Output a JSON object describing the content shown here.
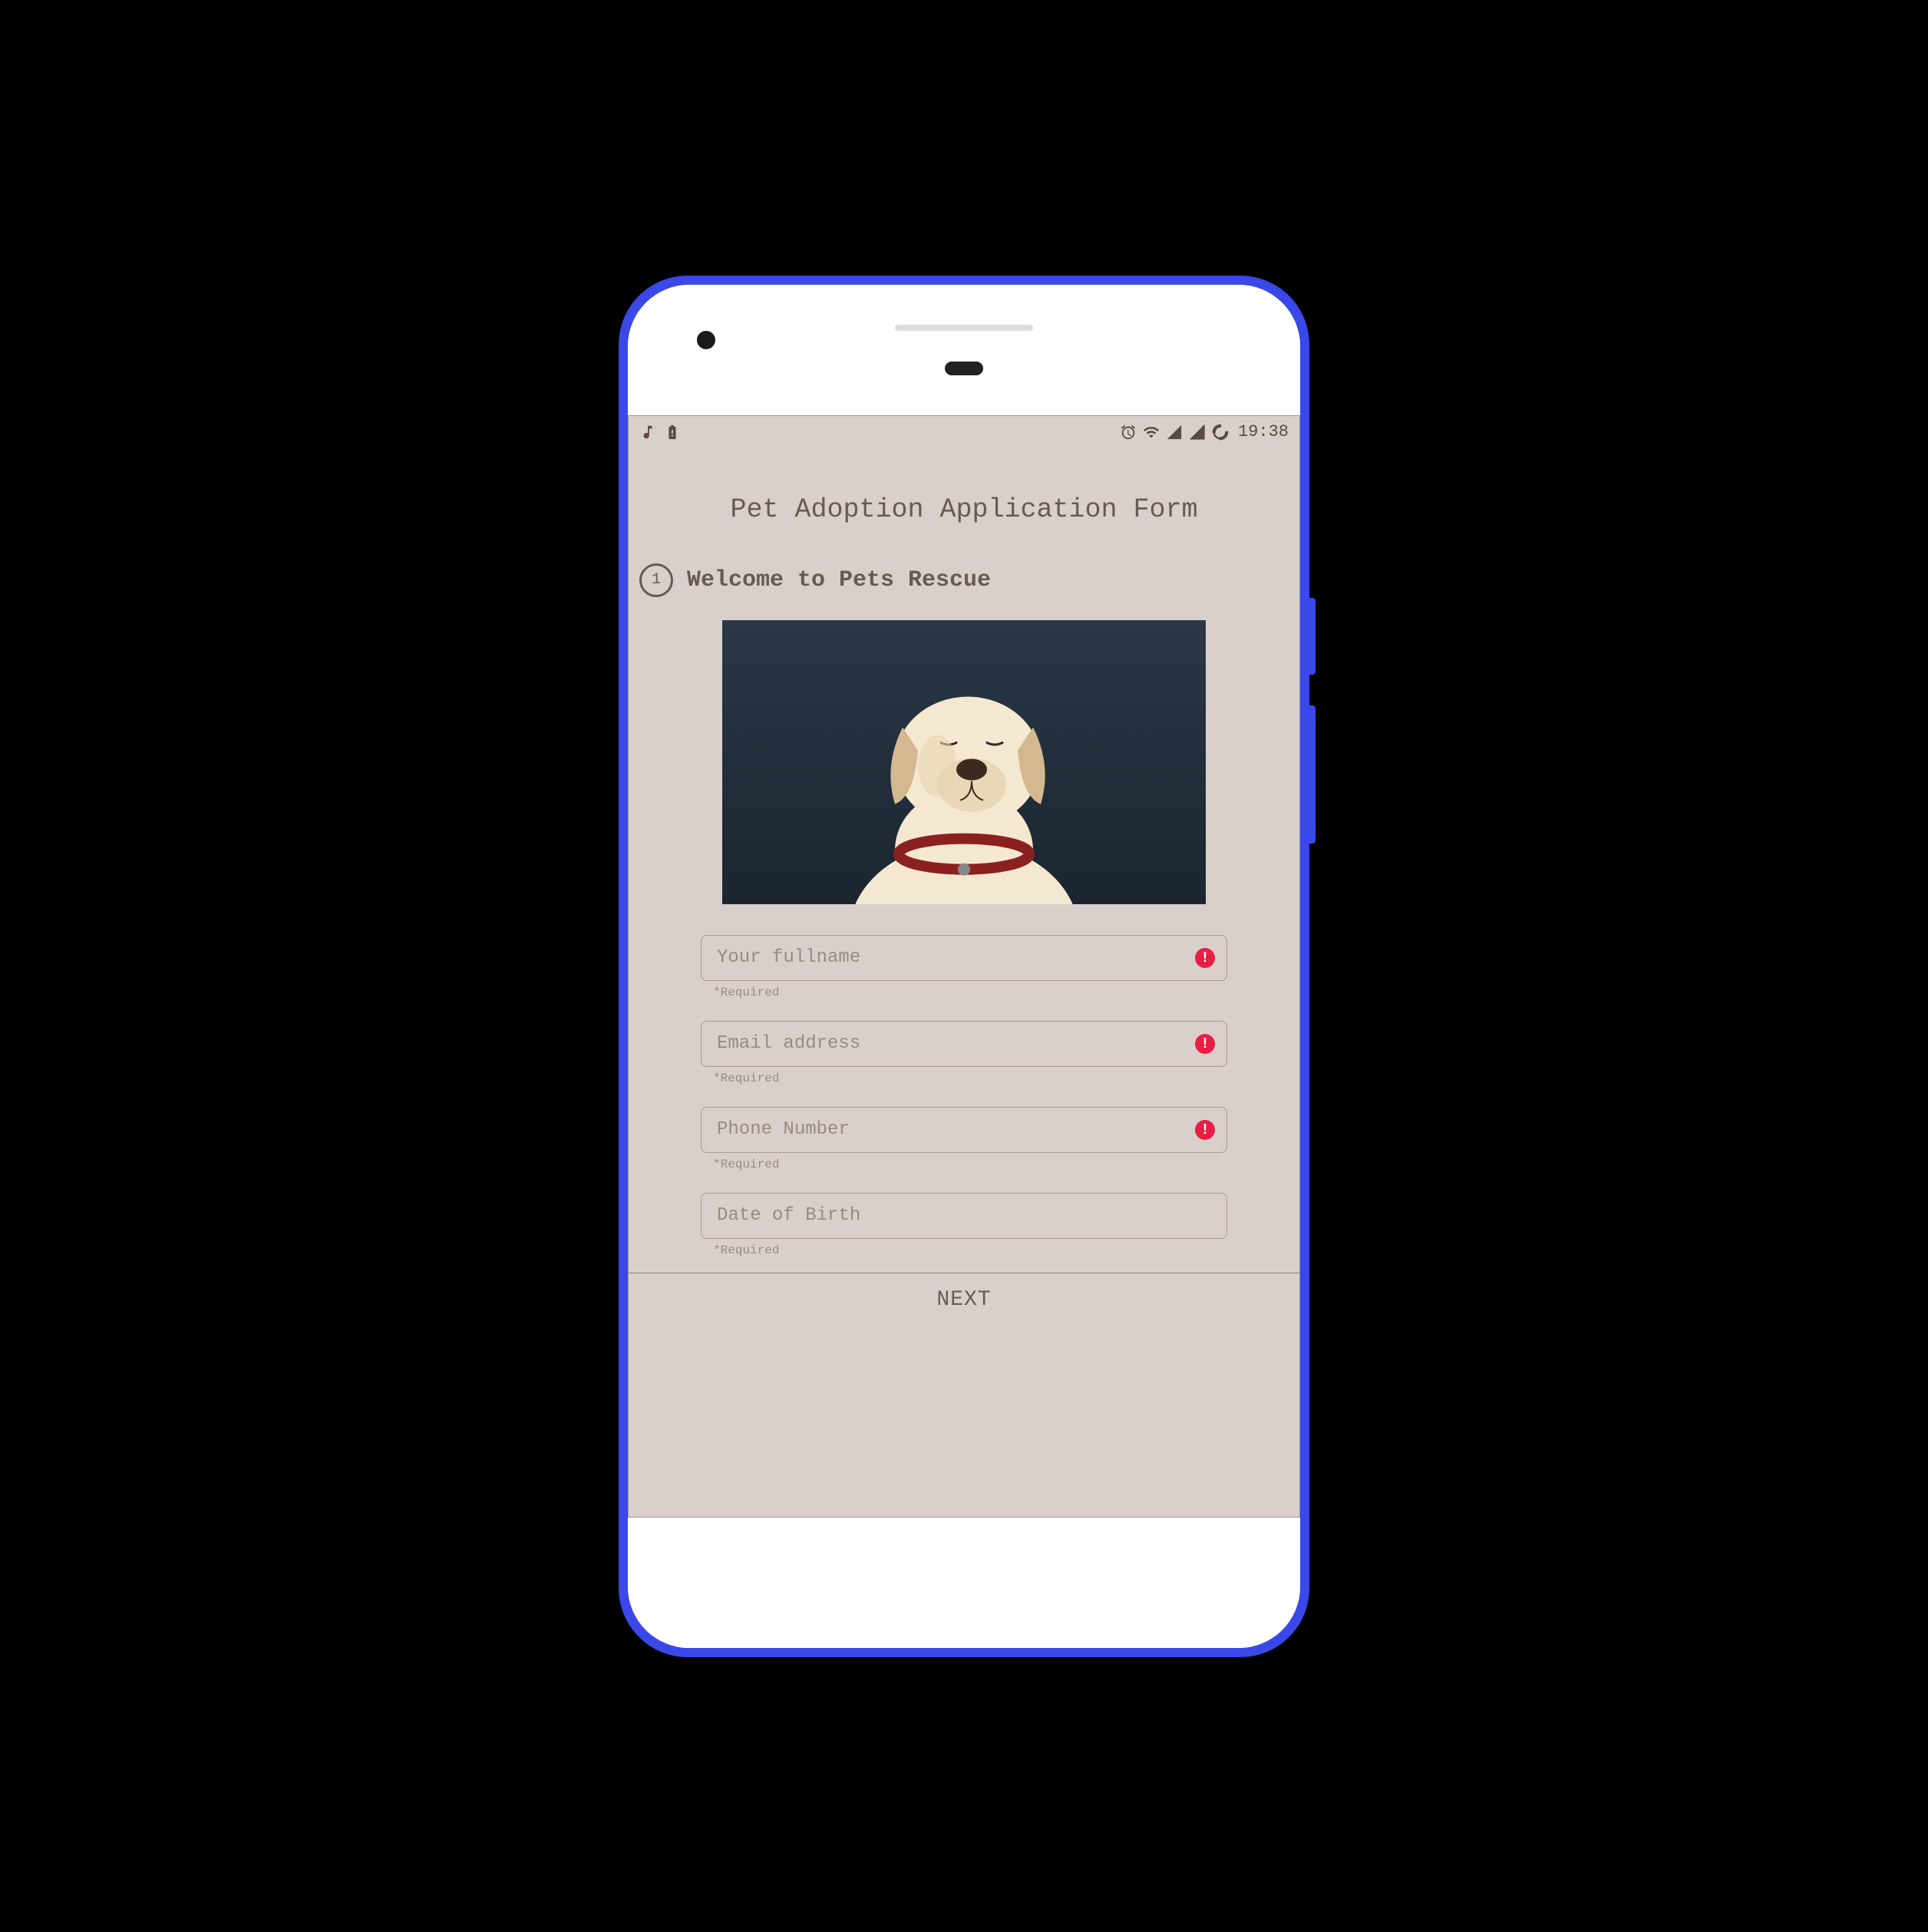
{
  "status_bar": {
    "time": "19:38"
  },
  "page": {
    "title": "Pet Adoption Application Form"
  },
  "step": {
    "number": "1",
    "title": "Welcome to Pets Rescue"
  },
  "fields": {
    "fullname": {
      "placeholder": "Your fullname",
      "hint": "*Required",
      "has_error": true
    },
    "email": {
      "placeholder": "Email address",
      "hint": "*Required",
      "has_error": true
    },
    "phone": {
      "placeholder": "Phone Number",
      "hint": "*Required",
      "has_error": true
    },
    "dob": {
      "placeholder": "Date of Birth",
      "hint": "*Required",
      "has_error": false
    }
  },
  "footer": {
    "next_label": "NEXT"
  },
  "colors": {
    "background": "#dad0cb",
    "text": "#6a5a50",
    "error": "#e91e44",
    "phone_frame": "#3a48e8"
  }
}
